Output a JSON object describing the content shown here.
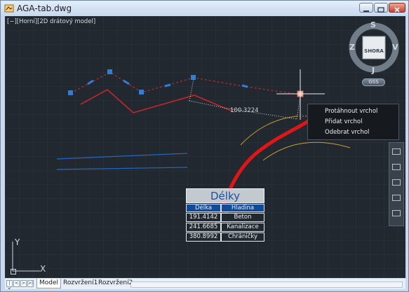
{
  "window": {
    "title": "AGA-tab.dwg"
  },
  "viewport": {
    "view_label": "[−][Horní][2D drátový model]",
    "dimension_value": "100.3224",
    "ucs": {
      "x": "X",
      "y": "Y"
    }
  },
  "viewcube": {
    "face": "SHORA",
    "north": "S",
    "south": "J",
    "east": "V",
    "west": "Z",
    "wcs_button": "GSS"
  },
  "context_menu": {
    "items": [
      "Protáhnout vrchol",
      "Přidat vrchol",
      "Odebrat vrchol"
    ]
  },
  "table": {
    "title": "Délky",
    "headers": [
      "Délka",
      "Hladina"
    ],
    "rows": [
      [
        "191.4142",
        "Beton"
      ],
      [
        "241.6685",
        "Kanalizace"
      ],
      [
        "380.8992",
        "Chráničky"
      ]
    ]
  },
  "layout_tabs": [
    "Model",
    "Rozvržení1",
    "Rozvržení2"
  ],
  "colors": {
    "background": "#212830",
    "red_polyline": "#c0282a",
    "grip_blue": "#2f7de0",
    "arrow_red": "#e01616",
    "arc_yellow": "#c9a229"
  }
}
